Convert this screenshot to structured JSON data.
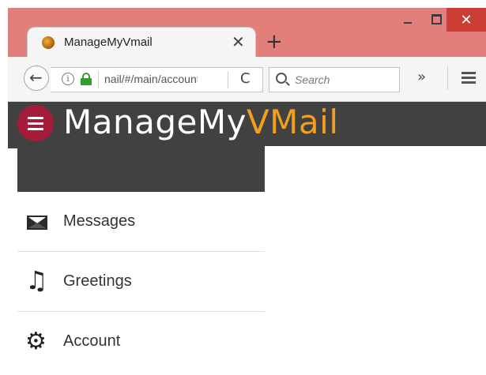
{
  "window": {
    "minimize_icon": "minimize-icon",
    "maximize_icon": "maximize-icon",
    "close_glyph": "✕"
  },
  "tab": {
    "title": "ManageMyVmail",
    "close_glyph": "✕",
    "new_tab_glyph": "+"
  },
  "navbar": {
    "back_glyph": "←",
    "info_glyph": "i",
    "url": "nail/#/main/account",
    "reload_glyph": "C",
    "search_placeholder": "Search",
    "overflow_glyph": "»"
  },
  "app": {
    "brand_part1": "ManageMy",
    "brand_part2": "VMail",
    "brand_colors": {
      "primary": "#ffffff",
      "accent": "#f0a01e"
    },
    "header_color": "#414141",
    "hamburger_highlight": "#a51b3a"
  },
  "drawer": {
    "items": [
      {
        "label": "Messages",
        "icon": "envelope-icon"
      },
      {
        "label": "Greetings",
        "icon": "music-note-icon"
      },
      {
        "label": "Account",
        "icon": "gear-icon"
      }
    ]
  }
}
